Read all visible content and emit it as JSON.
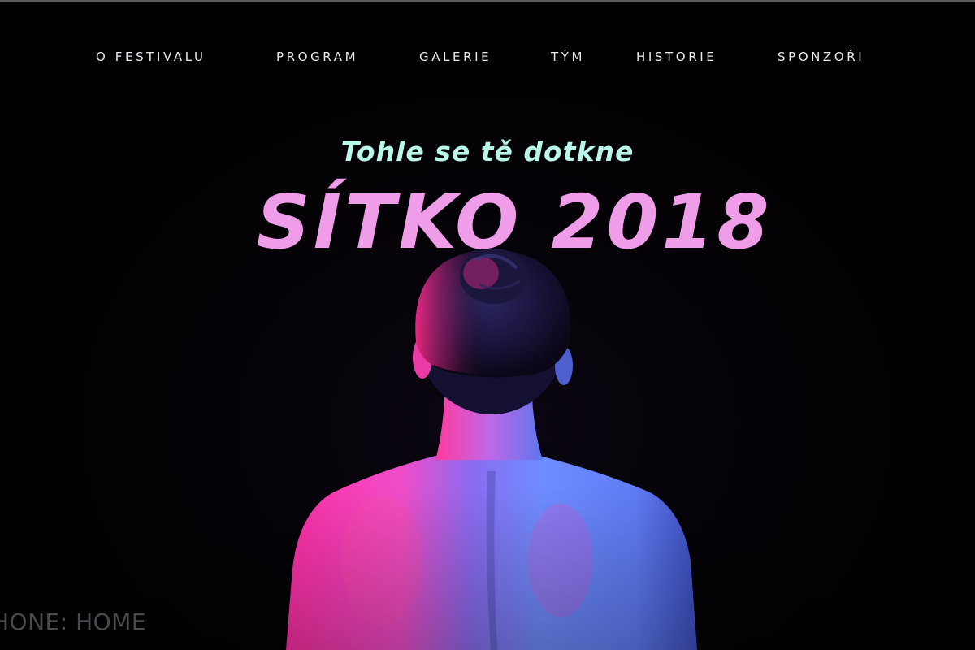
{
  "nav": {
    "items": [
      {
        "label": "O FESTIVALU"
      },
      {
        "label": "PROGRAM"
      },
      {
        "label": "GALERIE"
      },
      {
        "label": "TÝM"
      },
      {
        "label": "HISTORIE"
      },
      {
        "label": "SPONZOŘI"
      }
    ]
  },
  "hero": {
    "tagline": "Tohle se tě dotkne",
    "title": "SÍTKO 2018",
    "image_icon": "woman-back-photo"
  },
  "watermark": {
    "text": "HONE: HOME"
  },
  "colors": {
    "background": "#030103",
    "nav_text": "#e9e9ef",
    "tagline": "#b9f7ea",
    "title": "#ef9ce9",
    "accent_pink": "#ff3fb0",
    "accent_blue": "#5a78ff"
  }
}
